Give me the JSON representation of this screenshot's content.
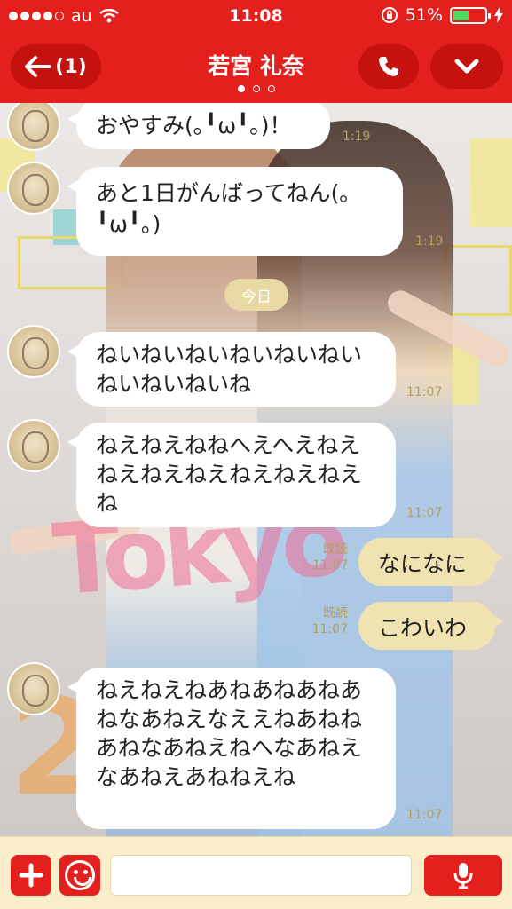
{
  "status_bar": {
    "carrier": "au",
    "time": "11:08",
    "battery": "51%",
    "battery_level": 0.51,
    "icons": [
      "signal-dots-icon",
      "wifi-icon",
      "rotation-lock-icon",
      "battery-icon",
      "charging-icon"
    ]
  },
  "header": {
    "back_label": "(1)",
    "title": "若宮 礼奈",
    "page_count": 3,
    "active_page": 0,
    "icons": [
      "back-arrow-icon",
      "phone-icon",
      "chevron-down-icon"
    ]
  },
  "messages": [
    {
      "side": "left",
      "text": "おやすみ(｡╹ω╹｡)！",
      "time": "1:19"
    },
    {
      "side": "left",
      "text": "あと1日がんばってねん(｡╹ω╹｡)",
      "time": "1:19"
    },
    {
      "side": "left",
      "text": "ねいねいねいねいねいねいねいねいねいね",
      "time": "11:07"
    },
    {
      "side": "left",
      "text": "ねえねえねねへえへえねえねえねえねえねえねえねえね",
      "time": "11:07"
    },
    {
      "side": "right",
      "text": "なになに",
      "read": "既読",
      "time": "11:07"
    },
    {
      "side": "right",
      "text": "こわいわ",
      "read": "既読",
      "time": "11:07"
    },
    {
      "side": "left",
      "text": "ねえねえねあねあねあねあねなあねえなええねあねねあねなあねえねへなあねえなあねえあねねえね",
      "time": "11:07"
    }
  ],
  "date_separator": "今日",
  "background_art": {
    "text1": "Tokyo",
    "text2": "2"
  },
  "input_bar": {
    "placeholder": "",
    "icons": [
      "plus-icon",
      "emoji-icon",
      "microphone-icon"
    ]
  },
  "colors": {
    "brand_red": "#e3201e",
    "bubble_right": "#f0e3b1",
    "bubble_left": "#ffffff",
    "timestamp": "#b59f5e"
  }
}
